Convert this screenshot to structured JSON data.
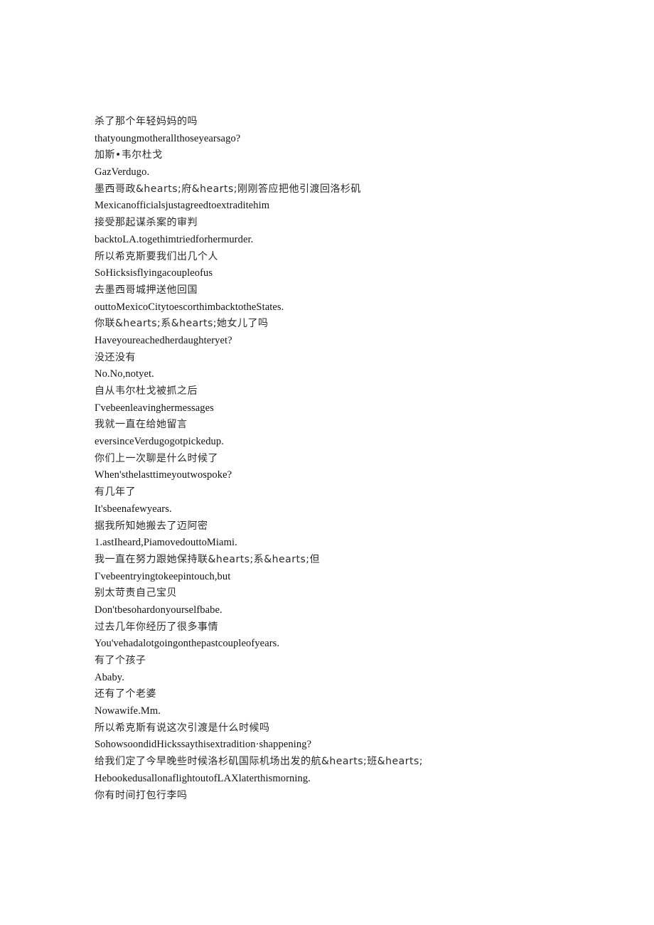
{
  "document": {
    "lines": [
      {
        "lang": "zh",
        "text": "杀了那个年轻妈妈的吗"
      },
      {
        "lang": "en",
        "text": "thatyoungmotherallthoseyearsago?"
      },
      {
        "lang": "zh",
        "text": "加斯•韦尔杜戈"
      },
      {
        "lang": "en",
        "text": "GazVerdugo."
      },
      {
        "lang": "zh",
        "text": "墨西哥政&hearts;府&hearts;刚刚答应把他引渡回洛杉矶"
      },
      {
        "lang": "en",
        "text": "Mexicanofficialsjustagreedtoextraditehim"
      },
      {
        "lang": "zh",
        "text": "接受那起谋杀案的审判"
      },
      {
        "lang": "en",
        "text": "backtoLA.togethimtriedforhermurder."
      },
      {
        "lang": "zh",
        "text": "所以希克斯要我们出几个人"
      },
      {
        "lang": "en",
        "text": "SoHicksisflyingacoupleofus"
      },
      {
        "lang": "zh",
        "text": "去墨西哥城押送他回国"
      },
      {
        "lang": "en",
        "text": "outtoMexicoCitytoescorthimbacktotheStates."
      },
      {
        "lang": "zh",
        "text": "你联&hearts;系&hearts;她女儿了吗"
      },
      {
        "lang": "en",
        "text": "Haveyoureachedherdaughteryet?"
      },
      {
        "lang": "zh",
        "text": "没还没有"
      },
      {
        "lang": "en",
        "text": "No.No,notyet."
      },
      {
        "lang": "zh",
        "text": "自从韦尔杜戈被抓之后"
      },
      {
        "lang": "en",
        "text": "Γvebeenleavinghermessages"
      },
      {
        "lang": "zh",
        "text": "我就一直在给她留言"
      },
      {
        "lang": "en",
        "text": "eversinceVerdugogotpickedup."
      },
      {
        "lang": "zh",
        "text": "你们上一次聊是什么时候了"
      },
      {
        "lang": "en",
        "text": "When'sthelasttimeyoutwospoke?"
      },
      {
        "lang": "zh",
        "text": "有几年了"
      },
      {
        "lang": "en",
        "text": "It'sbeenafewyears."
      },
      {
        "lang": "zh",
        "text": "据我所知她搬去了迈阿密"
      },
      {
        "lang": "en",
        "text": "1.astIheard,PiamovedouttoMiami."
      },
      {
        "lang": "zh",
        "text": "我一直在努力跟她保持联&hearts;系&hearts;但"
      },
      {
        "lang": "en",
        "text": "Γvebeentryingtokeepintouch,but"
      },
      {
        "lang": "zh",
        "text": "别太苛责自己宝贝"
      },
      {
        "lang": "en",
        "text": "Don'tbesohardonyourselfbabe."
      },
      {
        "lang": "zh",
        "text": "过去几年你经历了很多事情"
      },
      {
        "lang": "en",
        "text": "You'vehadalotgoingonthepastcoupleofyears."
      },
      {
        "lang": "zh",
        "text": "有了个孩子"
      },
      {
        "lang": "en",
        "text": "Ababy."
      },
      {
        "lang": "zh",
        "text": "还有了个老婆"
      },
      {
        "lang": "en",
        "text": "Nowawife.Mm."
      },
      {
        "lang": "zh",
        "text": "所以希克斯有说这次引渡是什么时候吗"
      },
      {
        "lang": "en",
        "text": "SohowsoondidHickssaythisextradition·shappening?"
      },
      {
        "lang": "zh",
        "text": "给我们定了今早晚些时候洛杉矶国际机场出发的航&hearts;班&hearts;"
      },
      {
        "lang": "en",
        "text": "HebookedusallonaflightoutofLAXlaterthismorning."
      },
      {
        "lang": "zh",
        "text": "你有时间打包行李吗"
      }
    ]
  }
}
